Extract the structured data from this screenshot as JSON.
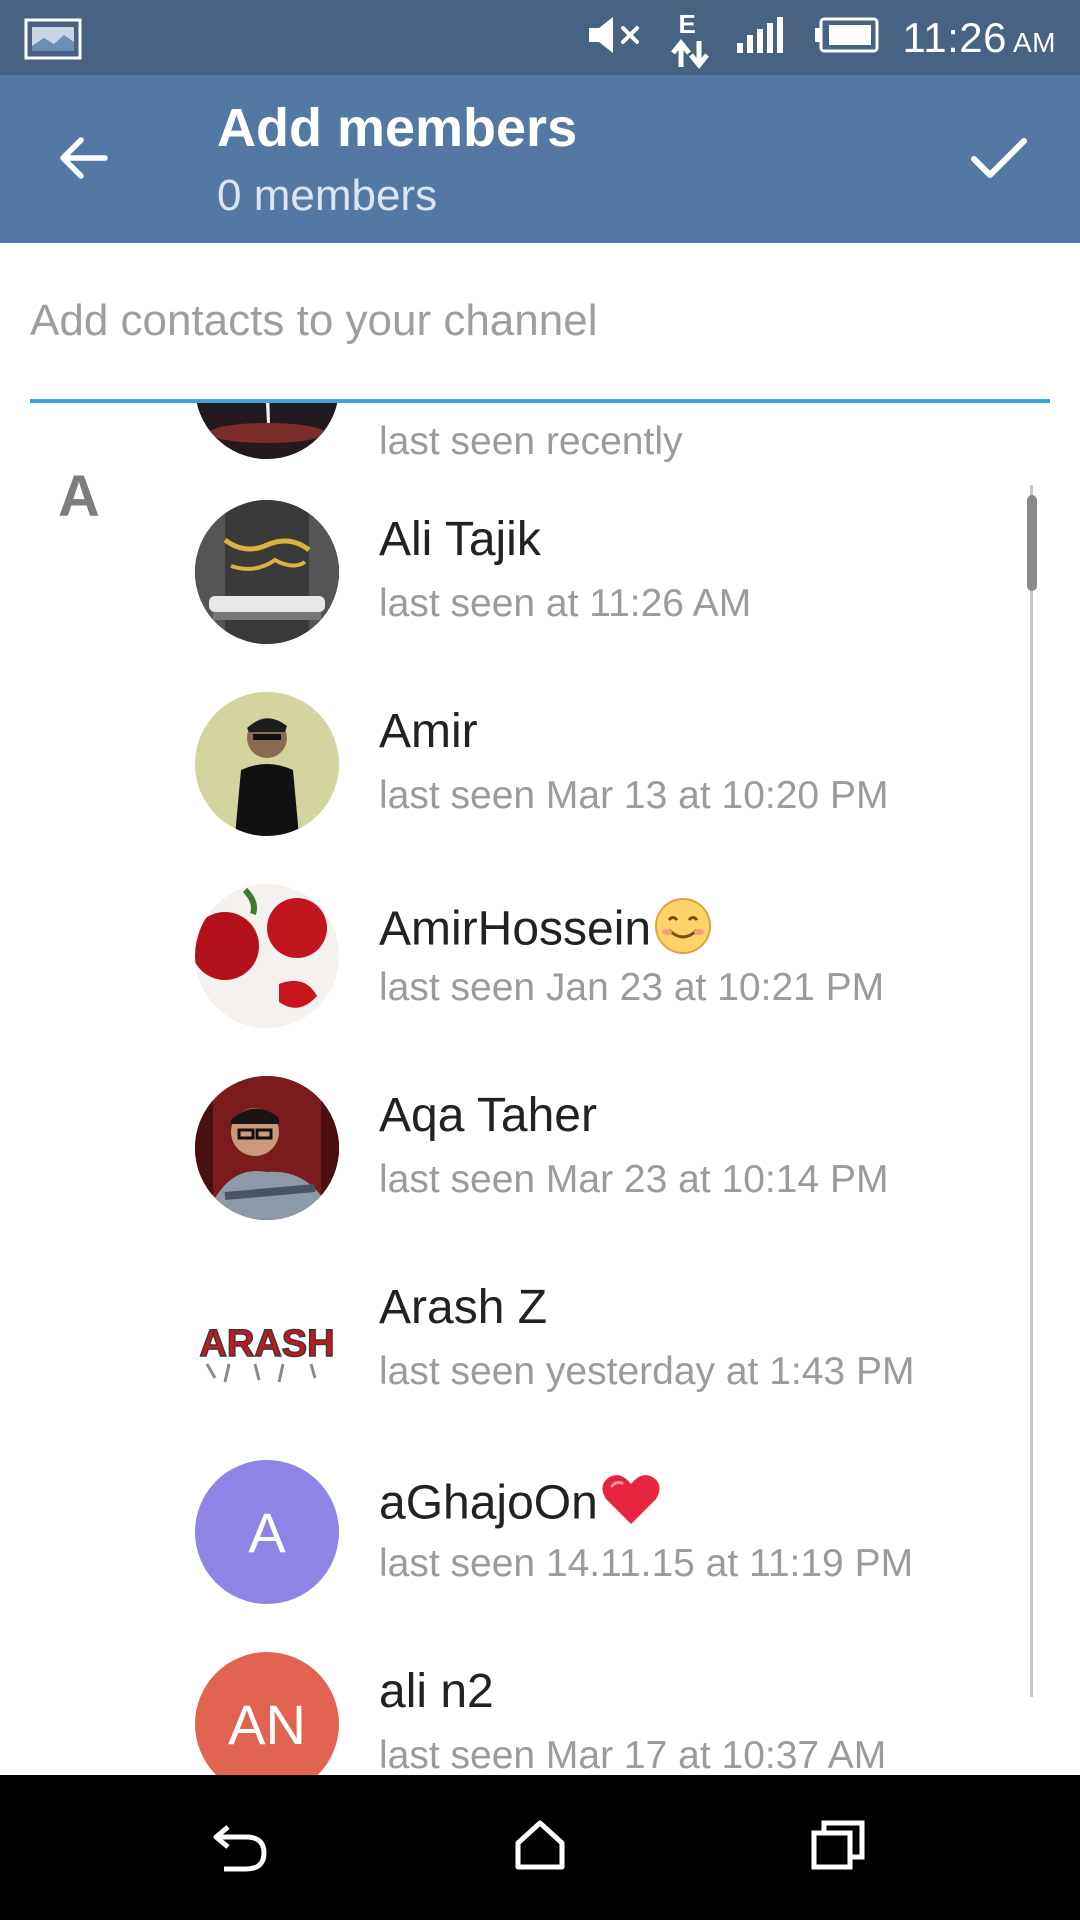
{
  "status_bar": {
    "time": "11:26",
    "ampm": "AM",
    "network_type": "E",
    "icons": [
      "notification-image-icon",
      "mute-icon",
      "data-transfer-icon",
      "signal-icon",
      "battery-icon"
    ]
  },
  "header": {
    "title": "Add members",
    "subtitle": "0 members",
    "back_icon": "arrow-left-icon",
    "confirm_icon": "check-icon"
  },
  "search": {
    "placeholder": "Add contacts to your channel",
    "value": "",
    "accent_color": "#3fa3e0"
  },
  "colors": {
    "status_bar": "#476282",
    "app_bar": "#5378a3",
    "avatar_purple": "#8e84e6",
    "avatar_red": "#e0644f"
  },
  "contacts": {
    "partial_top": {
      "status": "last seen recently"
    },
    "section_letter": "A",
    "items": [
      {
        "name": "Ali Tajik",
        "status": "last seen at 11:26 AM"
      },
      {
        "name": "Amir",
        "status": "last seen Mar 13 at 10:20 PM"
      },
      {
        "name": "AmirHossein",
        "status": "last seen Jan 23 at 10:21 PM",
        "emoji": "smiling-face-icon"
      },
      {
        "name": "Aqa Taher",
        "status": "last seen Mar 23 at 10:14 PM"
      },
      {
        "name": "Arash Z",
        "status": "last seen yesterday at 1:43 PM",
        "avatar_text": "ARASH"
      },
      {
        "name": "aGhajoOn",
        "status": "last seen 14.11.15 at 11:19 PM",
        "emoji": "red-heart-icon",
        "initials": "A"
      },
      {
        "name": "ali n2",
        "status": "last seen Mar 17 at 10:37 AM",
        "initials": "AN"
      }
    ]
  },
  "nav_bar": {
    "icons": [
      "back-nav-icon",
      "home-icon",
      "recents-icon"
    ]
  }
}
